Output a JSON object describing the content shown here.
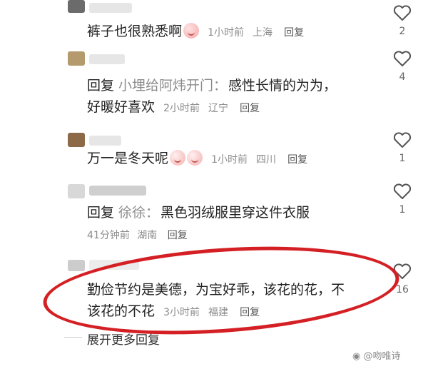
{
  "comments": [
    {
      "text": "裤子也很熟悉啊",
      "emoji": "peach-emoji",
      "time": "1小时前",
      "location": "上海",
      "reply_label": "回复",
      "likes": "2"
    },
    {
      "prefix": "回复",
      "reply_to": "小埋给阿炜开门：",
      "text_line1": "感性长情的为为，",
      "text_line2": "好暖好喜欢",
      "time": "2小时前",
      "location": "辽宁",
      "reply_label": "回复",
      "likes": "4"
    },
    {
      "text": "万一是冬天呢",
      "emoji": "crying-emoji",
      "time": "1小时前",
      "location": "四川",
      "reply_label": "回复",
      "likes": "1"
    },
    {
      "prefix": "回复",
      "reply_to": "徐徐：",
      "text": "黑色羽绒服里穿这件衣服",
      "time": "41分钟前",
      "location": "湖南",
      "reply_label": "回复",
      "likes": "1"
    },
    {
      "text_line1": "勤俭节约是美德，为宝好乖，该花的花，不",
      "text_line2": "该花的不花",
      "time": "3小时前",
      "location": "福建",
      "reply_label": "回复",
      "likes": "16"
    }
  ],
  "expand_label": "展开更多回复",
  "watermark": "@吻唯诗",
  "colors": {
    "highlight": "#d42024",
    "meta": "#8c8c8c"
  }
}
